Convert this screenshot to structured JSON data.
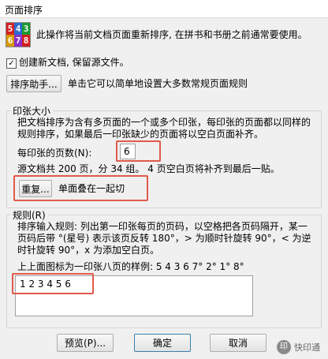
{
  "window": {
    "title": "页面排序"
  },
  "header": {
    "icon_digits": [
      "5",
      "4",
      "3",
      "6",
      "7",
      "8"
    ],
    "icon_colors": [
      "#d42020",
      "#2d6bd1",
      "#1a9a2e",
      "#d69a00",
      "#8a2fc8",
      "#d42020"
    ],
    "description": "此操作将当前文档页面重新排序, 在拼书和书册之前通常要使用。"
  },
  "options": {
    "create_new_doc_label": "创建新文档, 保留源文件。",
    "create_new_doc_checked": true
  },
  "helper": {
    "button_label": "排序助手...",
    "description": "单击它可以简单地设置大多数常规页面规则"
  },
  "print_sheet_group": {
    "legend": "印张大小",
    "description": "把文档排序为含有多页面的一个或多个印张，每印张的页面都以同样的规则排序，如果最后一印张缺少的页面将以空白页面补齐。",
    "pages_per_sheet_label": "每印张的页数(N):",
    "pages_per_sheet_value": "6",
    "source_info": "源文档共 200 页，分 34 组。 4 页空白页将补齐到最后一贴。",
    "repeat_button_label": "重复...",
    "repeat_description": "单面叠在一起切"
  },
  "rules_group": {
    "legend": "规则(R)",
    "description": "排序输入规则: 列出第一印张每页的页码，以空格把各页码隔开，某一页码后带 °(星号) 表示该页反转 180°，> 为顺时针旋转 90°，< 为逆时针旋转 90°，x 为添加空白页。",
    "example": "上上面图标为一印张八页的样例:  5 4 3 6 7° 2° 1° 8°",
    "rule_value": "1 2 3 4 5 6"
  },
  "footer": {
    "preview_label": "预览(P)...",
    "ok_label": "确定",
    "cancel_label": "取消"
  },
  "watermark": {
    "text": "快印通",
    "icon_glyph": "印"
  }
}
